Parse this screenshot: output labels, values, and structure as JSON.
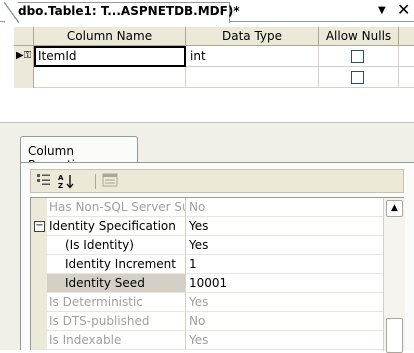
{
  "document_tab": {
    "title": "dbo.Table1: T...ASPNETDB.MDF)*",
    "dropdown_icon": "chevron-down-icon",
    "close_icon": "close-icon"
  },
  "grid": {
    "columns": [
      "Column Name",
      "Data Type",
      "Allow Nulls"
    ],
    "rows": [
      {
        "name": "ItemId",
        "type": "int",
        "allow_nulls": false,
        "primary_key": true
      },
      {
        "name": "",
        "type": "",
        "allow_nulls": false,
        "primary_key": false
      }
    ]
  },
  "column_properties": {
    "tab_label": "Column Properties",
    "toolbar": {
      "categorized_icon": "categorized-icon",
      "alphabetical_icon": "alphabetical-icon",
      "property_pages_icon": "property-pages-icon"
    },
    "properties": [
      {
        "name": "Has Non-SQL Server Sub:",
        "value": "No",
        "dim": true,
        "indent": 0
      },
      {
        "name": "Identity Specification",
        "value": "Yes",
        "dim": false,
        "indent": 0,
        "expander": "⊟"
      },
      {
        "name": "(Is Identity)",
        "value": "Yes",
        "dim": false,
        "indent": 1
      },
      {
        "name": "Identity Increment",
        "value": "1",
        "dim": false,
        "indent": 1
      },
      {
        "name": "Identity Seed",
        "value": "10001",
        "dim": false,
        "indent": 1,
        "selected": true
      },
      {
        "name": "Is Deterministic",
        "value": "Yes",
        "dim": true,
        "indent": 0
      },
      {
        "name": "Is DTS-published",
        "value": "No",
        "dim": true,
        "indent": 0
      },
      {
        "name": "Is Indexable",
        "value": "Yes",
        "dim": true,
        "indent": 0
      }
    ]
  }
}
